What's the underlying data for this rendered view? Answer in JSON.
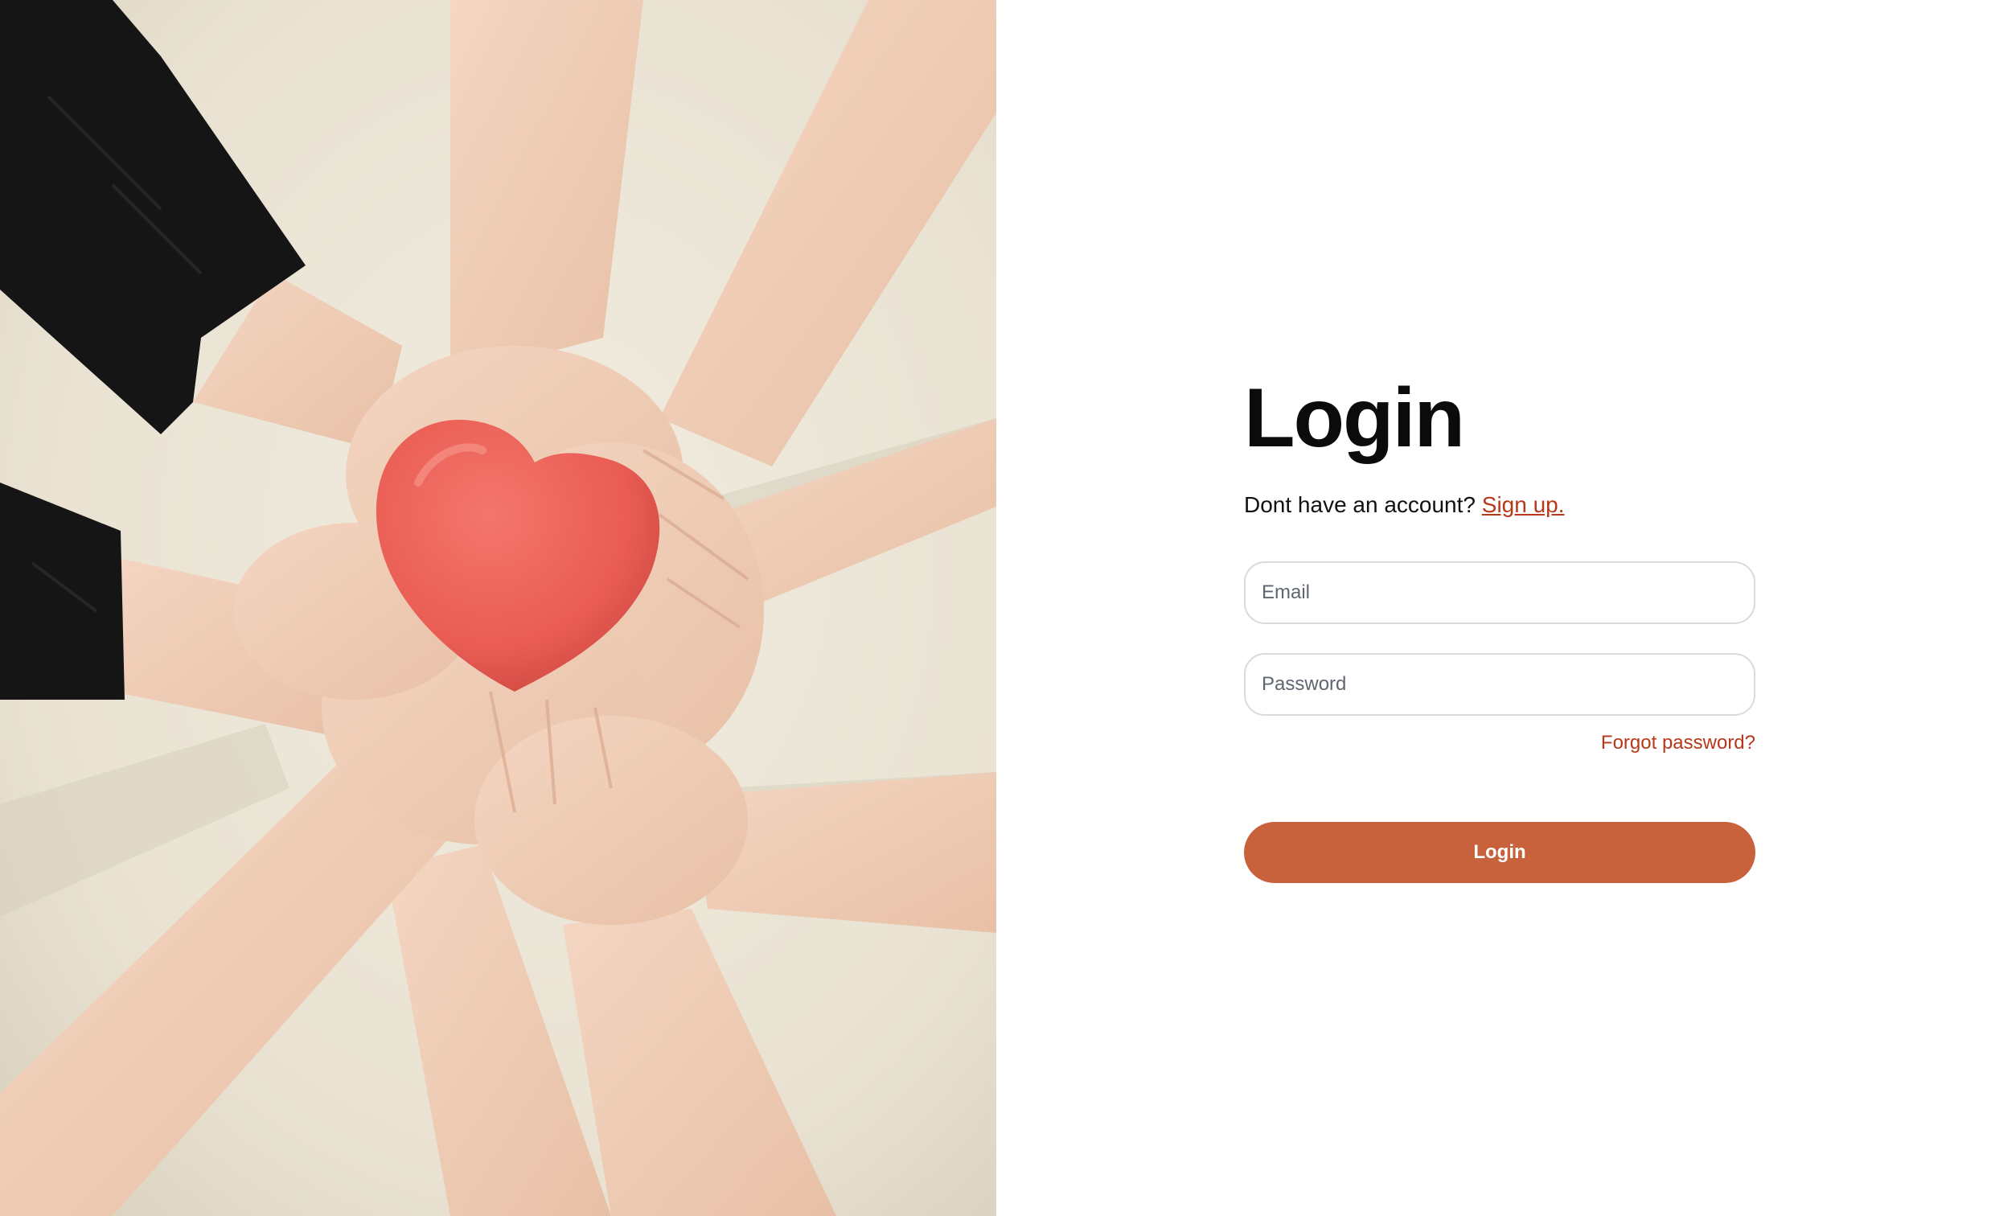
{
  "hero": {
    "image_icon": "hands-holding-heart-photo",
    "colors": {
      "background": "#ece6d8",
      "skin": "#f0cdb6",
      "sleeve": "#141414",
      "heart": "#ea5f57"
    }
  },
  "login": {
    "title": "Login",
    "signup_prompt": "Dont have an account?",
    "signup_link": "Sign up.",
    "email_placeholder": "Email",
    "password_placeholder": "Password",
    "forgot_label": "Forgot password?",
    "submit_label": "Login",
    "accent_color": "#b8381a",
    "button_color": "#c8623d"
  }
}
